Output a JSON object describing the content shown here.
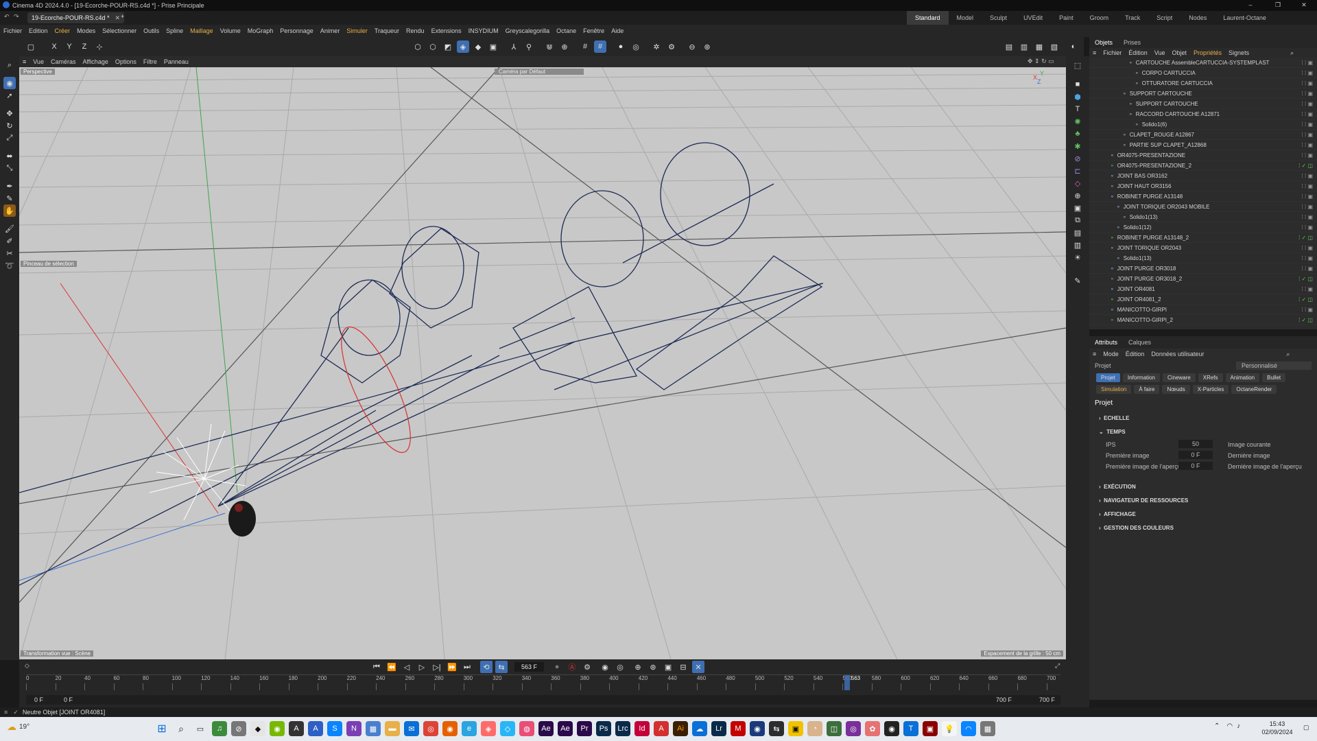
{
  "window": {
    "title": "Cinema 4D 2024.4.0 - [19-Ecorche-POUR-RS.c4d *] - Prise Principale",
    "minimize": "–",
    "maximize": "❐",
    "close": "✕"
  },
  "tabs": {
    "doc_tab": "19-Ecorche-POUR-RS.c4d *",
    "close": "✕",
    "add": "+"
  },
  "layouts": [
    "Standard",
    "Model",
    "Sculpt",
    "UVEdit",
    "Paint",
    "Groom",
    "Track",
    "Script",
    "Nodes",
    "Laurent-Octane"
  ],
  "menu": [
    "Fichier",
    "Edition",
    "Créer",
    "Modes",
    "Sélectionner",
    "Outils",
    "Spline",
    "Maillage",
    "Volume",
    "MoGraph",
    "Personnage",
    "Animer",
    "Simuler",
    "Traqueur",
    "Rendu",
    "Extensions",
    "INSYDIUM",
    "Greyscalegorilla",
    "Octane",
    "Fenêtre",
    "Aide"
  ],
  "viewport": {
    "menu": [
      "Vue",
      "Caméras",
      "Affichage",
      "Options",
      "Filtre",
      "Panneau"
    ],
    "label": "Perspective",
    "camera": "Caméra par Défaut",
    "tool_hint": "Pinceau de sélection",
    "bottom_left": "Transformation vue : Scène",
    "bottom_right": "Espacement de la grille : 50 cm",
    "axes": {
      "x": "X",
      "y": "Y",
      "z": "Z"
    }
  },
  "objects_panel": {
    "tabs": [
      "Objets",
      "Prises"
    ],
    "menu": [
      "Fichier",
      "Édition",
      "Vue",
      "Objet",
      "Propriétés",
      "Signets"
    ],
    "rows": [
      {
        "name": "CARTOUCHE AssembleCARTUCCIA-SYSTEMPLAST",
        "indent": 3,
        "check": false
      },
      {
        "name": "CORPO CARTUCCIA",
        "indent": 4,
        "check": false
      },
      {
        "name": "OTTURATORE CARTUCCIA",
        "indent": 4,
        "check": false
      },
      {
        "name": "SUPPORT CARTOUCHE",
        "indent": 2,
        "check": false
      },
      {
        "name": "SUPPORT CARTOUCHE",
        "indent": 3,
        "check": false
      },
      {
        "name": "RACCORD CARTOUCHE A12871",
        "indent": 3,
        "check": false
      },
      {
        "name": "Solido1(6)",
        "indent": 4,
        "check": false
      },
      {
        "name": "CLAPET_ROUGE A12867",
        "indent": 2,
        "check": false
      },
      {
        "name": "PARTIE SUP CLAPET_A12868",
        "indent": 2,
        "check": false
      },
      {
        "name": "OR4075-PRESENTAZIONE",
        "indent": 0,
        "check": false
      },
      {
        "name": "OR4075-PRESENTAZIONE_2",
        "indent": 0,
        "check": true
      },
      {
        "name": "JOINT BAS OR3162",
        "indent": 0,
        "check": false
      },
      {
        "name": "JOINT HAUT OR3156",
        "indent": 0,
        "check": false
      },
      {
        "name": "ROBINET PURGE A13148",
        "indent": 0,
        "check": false
      },
      {
        "name": "JOINT TORIQUE OR2043 MOBILE",
        "indent": 1,
        "check": false
      },
      {
        "name": "Solido1(13)",
        "indent": 2,
        "check": false
      },
      {
        "name": "Solido1(12)",
        "indent": 1,
        "check": false
      },
      {
        "name": "ROBINET PURGE A13148_2",
        "indent": 0,
        "check": true
      },
      {
        "name": "JOINT TORIQUE OR2043",
        "indent": 0,
        "check": false
      },
      {
        "name": "Solido1(13)",
        "indent": 1,
        "check": false
      },
      {
        "name": "JOINT PURGE OR3018",
        "indent": 0,
        "check": false
      },
      {
        "name": "JOINT PURGE OR3018_2",
        "indent": 0,
        "check": true
      },
      {
        "name": "JOINT OR4081",
        "indent": 0,
        "check": false
      },
      {
        "name": "JOINT OR4081_2",
        "indent": 0,
        "check": true
      },
      {
        "name": "MANICOTTO-GIRPI",
        "indent": 0,
        "check": false
      },
      {
        "name": "MANICOTTO-GIRPI_2",
        "indent": 0,
        "check": true
      }
    ]
  },
  "attributes_panel": {
    "tabs": [
      "Attributs",
      "Calques"
    ],
    "menu": [
      "Mode",
      "Édition",
      "Données utilisateur"
    ],
    "object_label": "Projet",
    "preset": "Personnalisé",
    "buttons_row1": [
      "Projet",
      "Information",
      "Cineware",
      "XRefs",
      "Animation",
      "Bullet"
    ],
    "buttons_row2": [
      "Simulation",
      "À faire",
      "Nœuds",
      "X-Particles",
      "OctaneRender"
    ],
    "heading": "Projet",
    "sections": {
      "echelle": "ECHELLE",
      "temps": "TEMPS",
      "execution": "EXÉCUTION",
      "navigateur": "NAVIGATEUR DE RESSOURCES",
      "affichage": "AFFICHAGE",
      "couleurs": "GESTION DES COULEURS"
    },
    "fields": {
      "ips_label": "IPS",
      "ips_value": "50",
      "first_label": "Première image",
      "first_value": "0 F",
      "preview_first_label": "Première image de l'aperçu",
      "preview_first_value": "0 F",
      "current_label": "Image courante",
      "last_label": "Dernière image",
      "preview_last_label": "Dernière image de l'aperçu"
    }
  },
  "timeline": {
    "current_frame": "563 F",
    "ticks": [
      "0",
      "20",
      "40",
      "60",
      "80",
      "100",
      "120",
      "140",
      "160",
      "180",
      "200",
      "220",
      "240",
      "260",
      "280",
      "300",
      "320",
      "340",
      "360",
      "380",
      "400",
      "420",
      "440",
      "460",
      "480",
      "500",
      "520",
      "540",
      "560",
      "580",
      "600",
      "620",
      "640",
      "660",
      "680",
      "700"
    ],
    "playhead_frame": 563,
    "playhead_label": "563",
    "start_a": "0 F",
    "start_b": "0 F",
    "end_a": "700 F",
    "end_b": "700 F"
  },
  "status": {
    "text": "Neutre Objet [JOINT OR4081]"
  },
  "taskbar": {
    "weather": "19°",
    "time": "15:43",
    "date": "02/09/2024"
  },
  "colors": {
    "accent": "#3f6fb3",
    "active_menu": "#e8b04a",
    "viewport_bg": "#c8c8c8",
    "wire": "#1d2a55"
  }
}
